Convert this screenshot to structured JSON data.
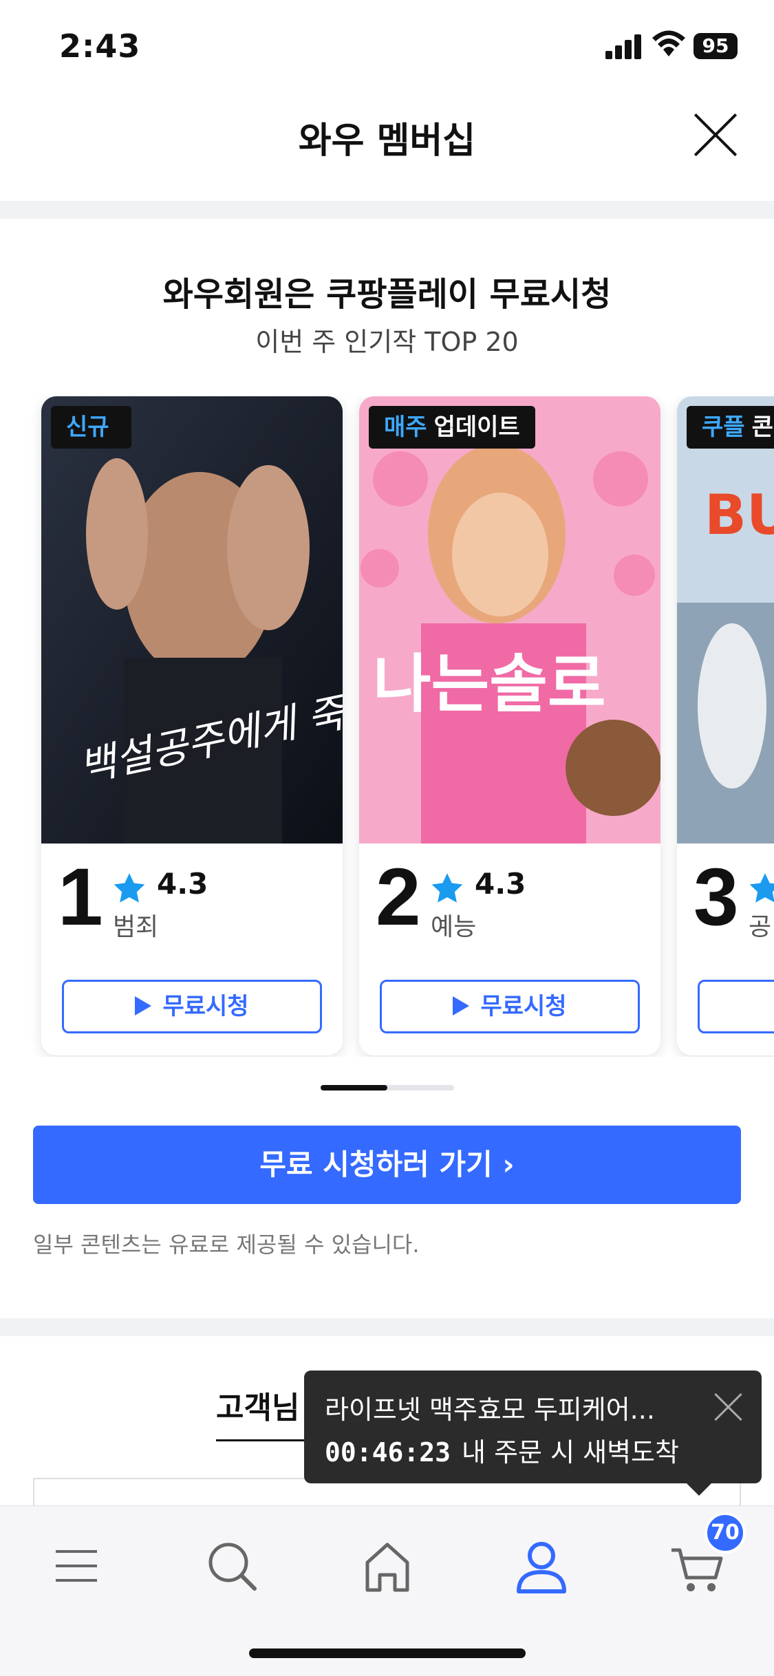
{
  "status": {
    "time": "2:43",
    "battery": "95"
  },
  "header": {
    "title": "와우 멤버십"
  },
  "section": {
    "title": "와우회원은 쿠팡플레이 무료시청",
    "subtitle": "이번 주 인기작 TOP 20"
  },
  "cards": [
    {
      "badge_accent": "신규",
      "badge_text": "",
      "rank": "1",
      "rating": "4.3",
      "genre": "범죄",
      "button": "무료시청",
      "poster_text": "백설공주에게 죽음을"
    },
    {
      "badge_accent": "매주",
      "badge_text": "업데이트",
      "rank": "2",
      "rating": "4.3",
      "genre": "예능",
      "button": "무료시청",
      "poster_text": "나는솔로"
    },
    {
      "badge_accent": "쿠플",
      "badge_text": "콘",
      "rank": "3",
      "rating": "",
      "genre": "공",
      "button": "",
      "poster_text": "BU C"
    }
  ],
  "cta": {
    "label": "무료 시청하러 가기 ›"
  },
  "disclaimer": "일부 콘텐츠는 유료로 제공될 수 있습니다.",
  "section2": {
    "title_partial": "고객님"
  },
  "toast": {
    "product": "라이프넷 맥주효모 두피케어...",
    "countdown": "00:46:23",
    "message": "내 주문 시 새벽도착"
  },
  "tabbar": {
    "cart_count": "70",
    "active_tab": "my"
  },
  "colors": {
    "accent": "#346aff",
    "badge_accent": "#3ea8ff",
    "star": "#1a9bf0"
  }
}
